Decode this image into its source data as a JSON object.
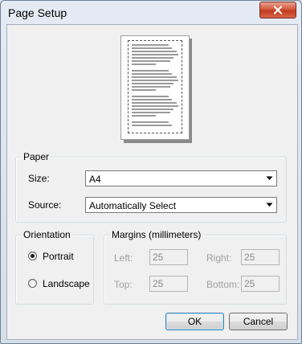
{
  "window": {
    "title": "Page Setup",
    "close_icon": "close-icon"
  },
  "paper_group": {
    "legend": "Paper",
    "size_label": "Size:",
    "size_value": "A4",
    "source_label": "Source:",
    "source_value": "Automatically Select"
  },
  "orientation_group": {
    "legend": "Orientation",
    "options": [
      {
        "label": "Portrait",
        "selected": true
      },
      {
        "label": "Landscape",
        "selected": false
      }
    ]
  },
  "margins_group": {
    "legend": "Margins (millimeters)",
    "left_label": "Left:",
    "left_value": "25",
    "right_label": "Right:",
    "right_value": "25",
    "top_label": "Top:",
    "top_value": "25",
    "bottom_label": "Bottom:",
    "bottom_value": "25"
  },
  "buttons": {
    "ok": "OK",
    "cancel": "Cancel"
  }
}
